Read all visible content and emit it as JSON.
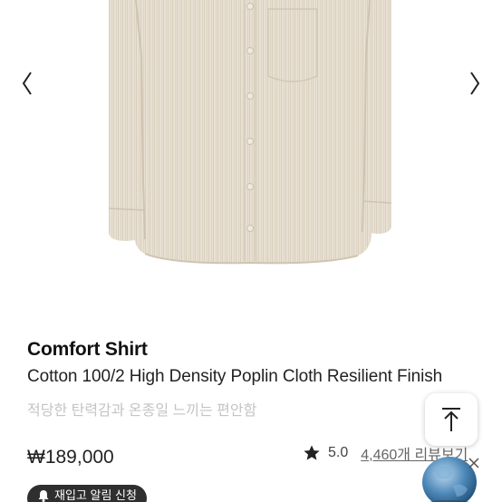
{
  "gallery": {
    "image_alt": "beige striped shirt",
    "prev_icon": "chevron-left-icon",
    "next_icon": "chevron-right-icon"
  },
  "product": {
    "name": "Comfort Shirt",
    "description": "Cotton 100/2 High Density Poplin Cloth Resilient Finish",
    "subtitle": "적당한 탄력감과 온종일 느끼는 편안함",
    "price": "₩189,000"
  },
  "rating": {
    "icon": "star-icon",
    "score": "5.0",
    "review_link": "4,460개 리뷰보기"
  },
  "buttons": {
    "top_icon": "arrow-up-icon",
    "restock_icon": "bell-icon",
    "restock_label": "재입고 알림 신청"
  },
  "colors": {
    "shirt": "#e6ded0",
    "text_primary": "#111111",
    "text_muted": "#c4c4c4",
    "restock_bg": "#2f2f2f"
  }
}
